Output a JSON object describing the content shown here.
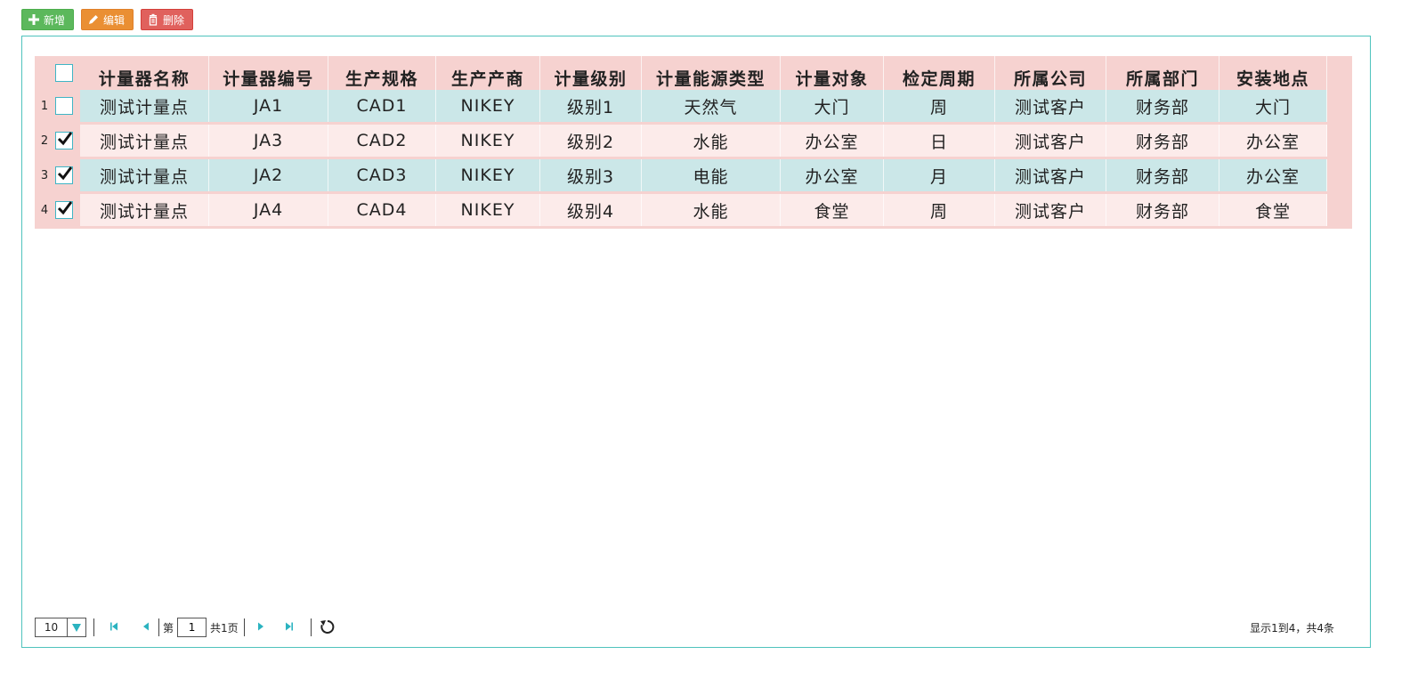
{
  "toolbar": {
    "add_label": "新增",
    "edit_label": "编辑",
    "delete_label": "删除",
    "add_color": "#5cb85c",
    "edit_color": "#ea8f33",
    "delete_color": "#e0615d"
  },
  "table": {
    "columns": [
      "计量器名称",
      "计量器编号",
      "生产规格",
      "生产产商",
      "计量级别",
      "计量能源类型",
      "计量对象",
      "检定周期",
      "所属公司",
      "所属部门",
      "安装地点"
    ],
    "rows": [
      {
        "num": "1",
        "checked": false,
        "cells": [
          "测试计量点",
          "JA1",
          "CAD1",
          "NIKEY",
          "级别1",
          "天然气",
          "大门",
          "周",
          "测试客户",
          "财务部",
          "大门"
        ]
      },
      {
        "num": "2",
        "checked": true,
        "cells": [
          "测试计量点",
          "JA3",
          "CAD2",
          "NIKEY",
          "级别2",
          "水能",
          "办公室",
          "日",
          "测试客户",
          "财务部",
          "办公室"
        ]
      },
      {
        "num": "3",
        "checked": true,
        "cells": [
          "测试计量点",
          "JA2",
          "CAD3",
          "NIKEY",
          "级别3",
          "电能",
          "办公室",
          "月",
          "测试客户",
          "财务部",
          "办公室"
        ]
      },
      {
        "num": "4",
        "checked": true,
        "cells": [
          "测试计量点",
          "JA4",
          "CAD4",
          "NIKEY",
          "级别4",
          "水能",
          "食堂",
          "周",
          "测试客户",
          "财务部",
          "食堂"
        ]
      }
    ],
    "colors": {
      "header_bg": "#f6d2d0",
      "odd_row": "#cbe7e8",
      "even_row": "#fcebea"
    }
  },
  "pager": {
    "page_size": "10",
    "page_prefix": "第",
    "current_page": "1",
    "total_pages": "共1页",
    "info": "显示1到4，共4条",
    "accent": "#2bb3c0"
  },
  "icons": {
    "add": "plus-icon",
    "edit": "pencil-icon",
    "delete": "trash-icon",
    "first": "first-page-icon",
    "prev": "prev-page-icon",
    "next": "next-page-icon",
    "last": "last-page-icon",
    "refresh": "refresh-icon",
    "dropdown": "dropdown-arrow-icon"
  }
}
